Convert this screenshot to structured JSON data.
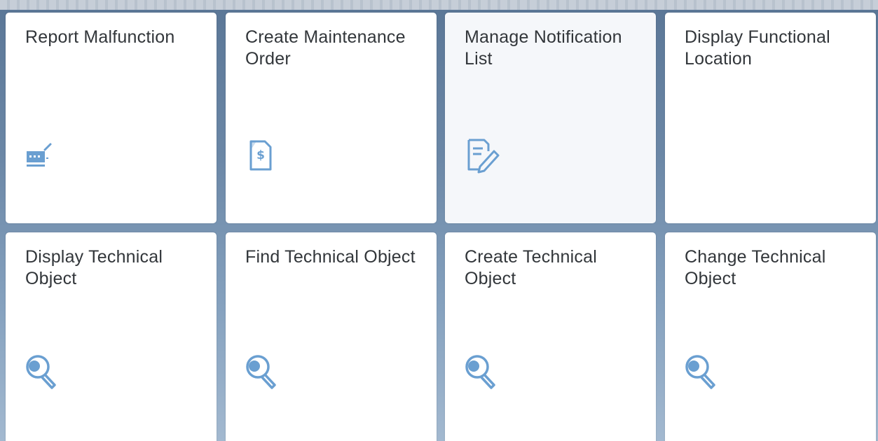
{
  "tiles": [
    {
      "title": "Report Malfunction",
      "icon": "report-malfunction-icon"
    },
    {
      "title": "Create Maintenance Order",
      "icon": "maintenance-order-icon"
    },
    {
      "title": "Manage Notification List",
      "icon": "notification-list-icon"
    },
    {
      "title": "Display Functional Location",
      "icon": ""
    },
    {
      "title": "Display Technical Object",
      "icon": "technical-object-icon"
    },
    {
      "title": "Find Technical Object",
      "icon": "technical-object-icon"
    },
    {
      "title": "Create Technical Object",
      "icon": "technical-object-icon"
    },
    {
      "title": "Change Technical Object",
      "icon": "technical-object-icon"
    }
  ],
  "colors": {
    "tile_background": "#ffffff",
    "tile_highlight": "#f5f7fa",
    "title_text": "#32363a",
    "icon": "#6a9fd1"
  }
}
